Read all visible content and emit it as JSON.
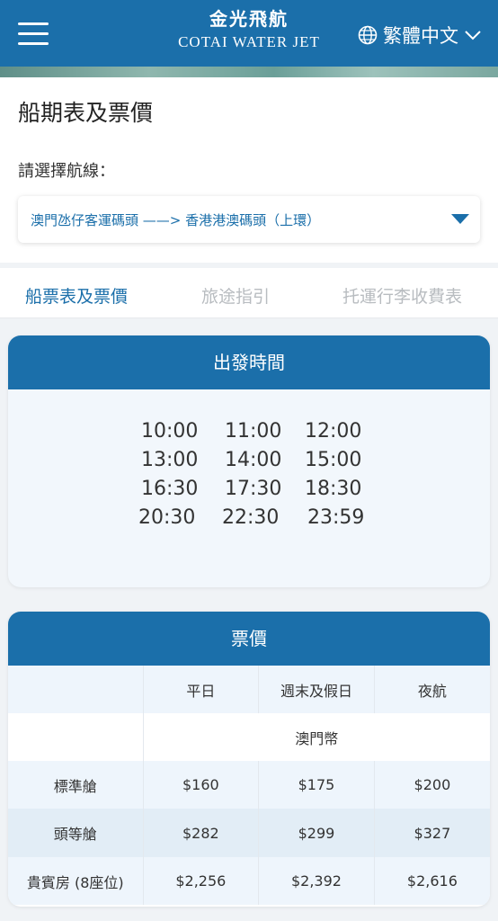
{
  "header": {
    "logo_cn": "金光飛航",
    "logo_en": "COTAI WATER JET",
    "language": "繁體中文"
  },
  "page": {
    "title": "船期表及票價",
    "route_label": "請選擇航線：",
    "route_value": "澳門氹仔客運碼頭 ——> 香港港澳碼頭（上環）"
  },
  "tabs": [
    {
      "label": "船票表及票價",
      "active": true
    },
    {
      "label": "旅途指引",
      "active": false
    },
    {
      "label": "托運行李收費表",
      "active": false
    }
  ],
  "departure": {
    "title": "出發時間",
    "times": [
      [
        "10:00",
        "11:00",
        "12:00"
      ],
      [
        "13:00",
        "14:00",
        "15:00"
      ],
      [
        "16:30",
        "17:30",
        "18:30"
      ],
      [
        "20:30",
        "22:30",
        "23:59"
      ]
    ]
  },
  "fares": {
    "title": "票價",
    "columns": [
      "",
      "平日",
      "週末及假日",
      "夜航"
    ],
    "currency": "澳門幣",
    "rows": [
      {
        "class": "標準艙",
        "weekday": "$160",
        "weekend": "$175",
        "night": "$200"
      },
      {
        "class": "頭等艙",
        "weekday": "$282",
        "weekend": "$299",
        "night": "$327"
      },
      {
        "class": "貴賓房 (8座位)",
        "weekday": "$2,256",
        "weekend": "$2,392",
        "night": "$2,616"
      }
    ]
  },
  "colors": {
    "brand_blue": "#1b6faa",
    "inactive_tab": "#b8bcc0"
  }
}
